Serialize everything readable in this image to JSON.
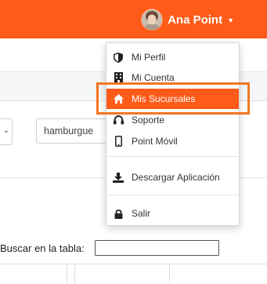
{
  "header": {
    "user_name": "Ana Point",
    "caret_icon": "caret-down-icon",
    "background": "#fe5b19"
  },
  "filters": {
    "search_term": "hamburgue"
  },
  "table_search": {
    "label": "Buscar en la tabla:",
    "value": ""
  },
  "user_menu": {
    "items": [
      {
        "label": "Mi Perfil",
        "icon": "shield-icon"
      },
      {
        "label": "Mi Cuenta",
        "icon": "building-icon"
      },
      {
        "label": "Mis Sucursales",
        "icon": "home-icon",
        "active": true
      },
      {
        "label": "Soporte",
        "icon": "headset-icon"
      },
      {
        "label": "Point Móvil",
        "icon": "mobile-icon"
      },
      {
        "label": "Descargar Aplicación",
        "icon": "download-icon"
      },
      {
        "label": "Salir",
        "icon": "lock-icon"
      }
    ],
    "active_color": "#fe5b19",
    "highlight_color": "#f47524"
  }
}
